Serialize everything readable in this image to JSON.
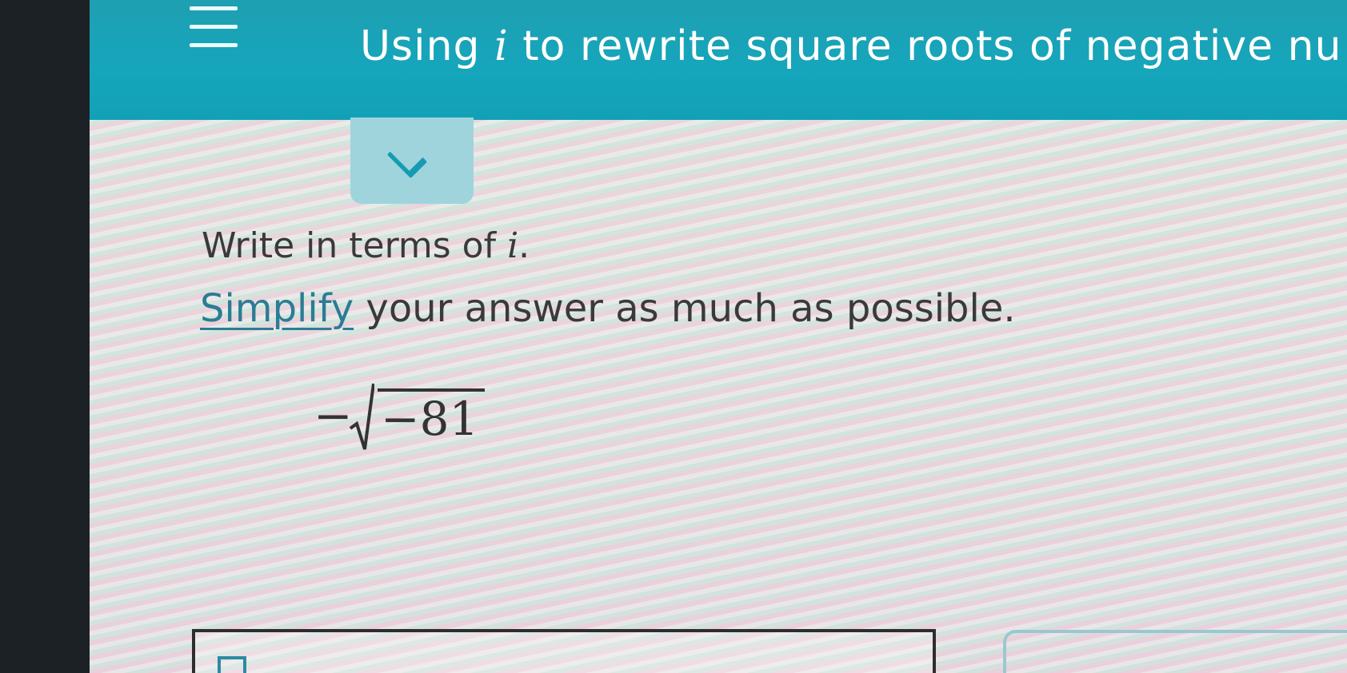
{
  "header": {
    "title_before": "Using ",
    "title_var": "i",
    "title_after": " to rewrite square roots of negative nu"
  },
  "question": {
    "instruction_before": "Write in terms of ",
    "instruction_var": "i",
    "instruction_after": ".",
    "link_label": "Simplify",
    "line2_after": " your answer as much as possible.",
    "expression": {
      "sign": "−",
      "radicand": "−81"
    }
  },
  "colors": {
    "header": "#15a6bc",
    "link": "#2a7d94",
    "text": "#3a3a3a"
  },
  "icons": [
    "hamburger-menu-icon",
    "chevron-down-icon",
    "radical-icon",
    "placeholder-icon"
  ]
}
